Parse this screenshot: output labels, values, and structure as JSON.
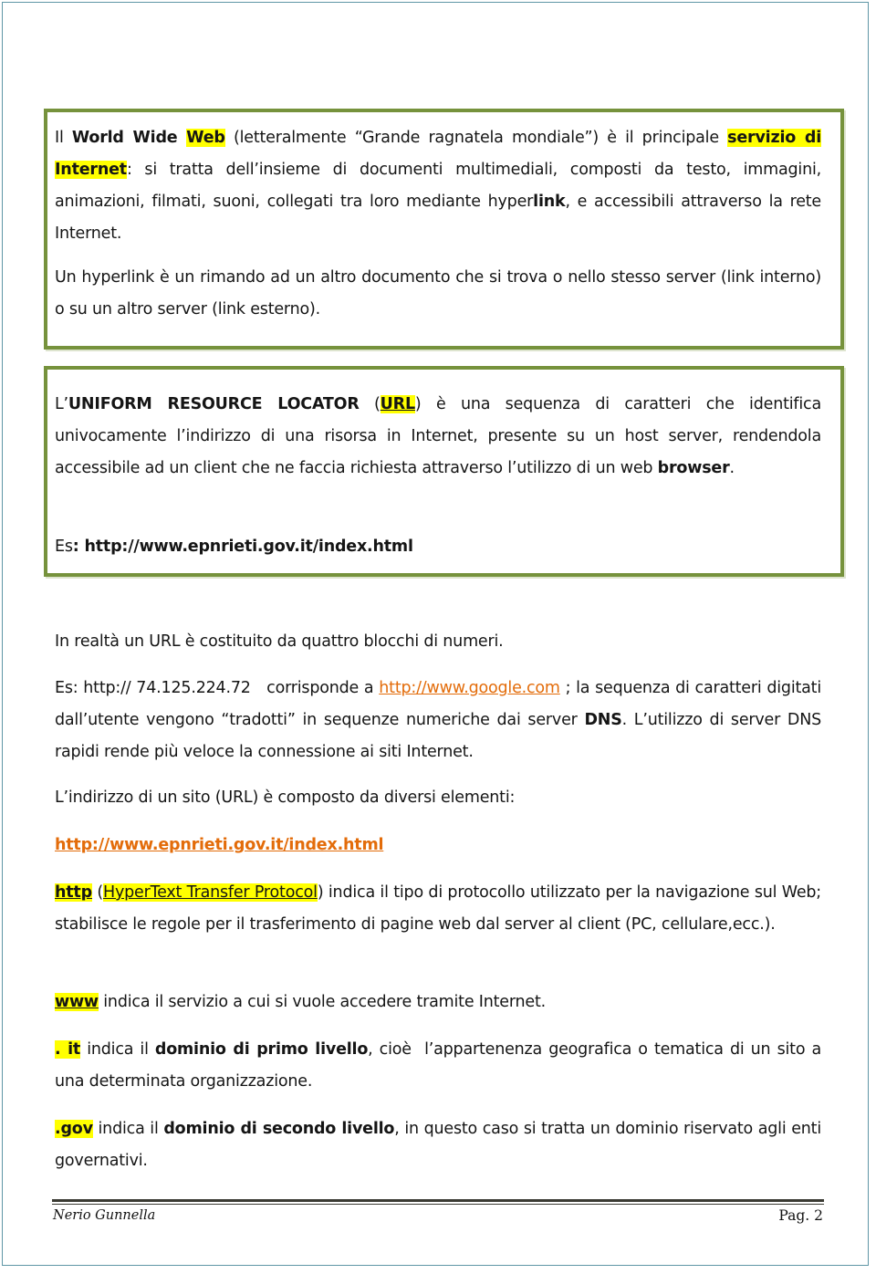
{
  "box1": {
    "p1": {
      "t1": "Il ",
      "world_wide": "World Wide ",
      "web": "Web",
      "t2": " (letteralmente “Grande ragnatela mondiale”) è il principale ",
      "servizio": "servizio di Internet",
      "t3": ": si tratta dell’insieme di documenti multimediali, composti da testo, immagini, animazioni, filmati, suoni, collegati tra loro mediante hyper",
      "link_bold": "link",
      "t4": ", e accessibili attraverso la rete Internet."
    },
    "p2": "Un hyperlink è un rimando ad un altro documento che si trova o nello stesso server (link interno) o su un altro server (link esterno)."
  },
  "box2": {
    "p1": {
      "t1": "L’",
      "uniform": "UNIFORM RESOURCE LOCATOR",
      "t2": " (",
      "url": "URL",
      "t3": ") è una sequenza di caratteri che identifica univocamente l’indirizzo di una risorsa in Internet, presente su un host server, rendendola accessibile ad un client che ne faccia richiesta attraverso l’utilizzo di un web ",
      "browser": "browser",
      "t4": "."
    },
    "example": {
      "prefix": "Es",
      "colon": ": ",
      "url": "http://www.epnrieti.gov.it/index.html"
    }
  },
  "body": {
    "p_blocks": "In realtà un URL è costituito da quattro blocchi di numeri.",
    "p_example": {
      "t1": "Es: http:// 74.125.224.72   corrisponde a ",
      "google_link": "http://www.google.com",
      "t2": " ; la sequenza di caratteri digitati dall’utente vengono “tradotti” in sequenze numeriche dai server ",
      "dns": "DNS",
      "t3": ". L’utilizzo di server DNS rapidi rende più veloce la connessione ai siti Internet."
    },
    "p_composed": "L’indirizzo di un sito (URL) è composto da diversi elementi:",
    "url_link": "http://www.epnrieti.gov.it/index.html",
    "p_http": {
      "http": "http",
      "t1": " (",
      "protocol": "HyperText Transfer Protocol",
      "t2": ") indica il tipo di protocollo utilizzato per la navigazione sul Web; stabilisce le regole per il trasferimento di pagine web dal server al client (PC, cellulare,ecc.)."
    },
    "p_www": {
      "www": "www",
      "t1": " indica il servizio a cui si vuole accedere tramite Internet."
    },
    "p_it": {
      "it": ". it",
      "t1": " indica il ",
      "primo": "dominio di primo livello",
      "t2": ", cioè  l’appartenenza geografica o tematica di un sito a una determinata organizzazione."
    },
    "p_gov": {
      "gov": ".gov",
      "t1": " indica il ",
      "secondo": "dominio di secondo livello",
      "t2": ", in questo caso si tratta un dominio riservato agli enti governativi."
    }
  },
  "footer": {
    "author": "Nerio Gunnella",
    "page": "Pag. 2"
  }
}
